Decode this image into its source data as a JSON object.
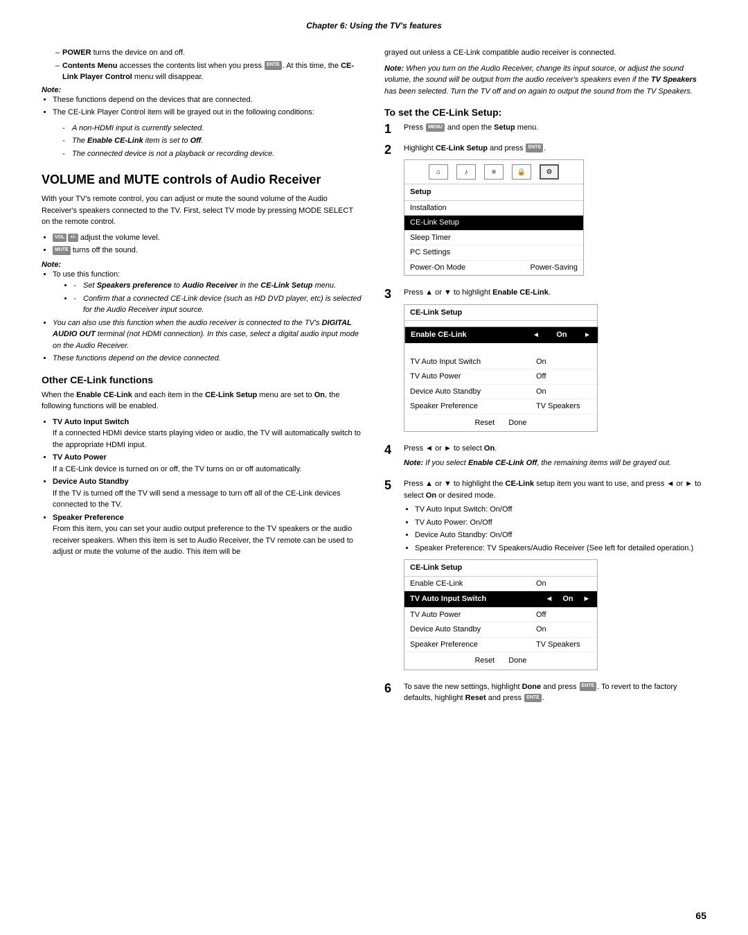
{
  "page": {
    "chapter_header": "Chapter 6: Using the TV's features",
    "page_number": "65",
    "left_col": {
      "bullet_intro": [
        {
          "text": "POWER turns the device on and off.",
          "bold_word": "POWER"
        },
        {
          "text": "Contents Menu accesses the contents list when you press  . At this time, the CE-Link Player Control menu will disappear.",
          "bold_word": "Contents Menu"
        }
      ],
      "note_label": "Note:",
      "note_items": [
        "These functions depend on the devices that are connected.",
        "The CE-Link Player Control item will be grayed out in the following conditions:"
      ],
      "conditions": [
        "A non-HDMI input is currently selected.",
        "The Enable CE-Link item is set to Off.",
        "The connected device is not a playback or recording device."
      ],
      "section1_title": "VOLUME and MUTE controls of Audio Receiver",
      "section1_body": "With your TV's remote control, you can adjust or mute the sound volume of the Audio Receiver's speakers connected to the TV. First, select TV mode by pressing MODE SELECT on the remote control.",
      "section1_bullets": [
        "adjust the volume level.",
        "turns off the sound."
      ],
      "note2_label": "Note:",
      "note2_items": [
        "To use this function:"
      ],
      "note2_sub": [
        "Set Speakers preference to Audio Receiver in the CE-Link Setup menu.",
        "Confirm that a connected CE-Link device (such as HD DVD player, etc) is selected for the Audio Receiver input source."
      ],
      "note2_extra": [
        "You can also use this function when the audio receiver is connected to the TV's DIGITAL AUDIO OUT terminal (not HDMI connection). In this case, select a digital audio input mode on the Audio Receiver.",
        "These functions depend on the device connected."
      ],
      "section2_title": "Other CE-Link functions",
      "section2_body": "When the Enable CE-Link and each item in the CE-Link Setup menu are set to On, the following functions will be enabled.",
      "sub_sections": [
        {
          "title": "TV Auto Input Switch",
          "body": "If a connected HDMI device starts playing video or audio, the TV will automatically switch to the appropriate HDMI input."
        },
        {
          "title": "TV Auto Power",
          "body": "If a CE-Link device is turned on or off, the TV turns on or off automatically."
        },
        {
          "title": "Device Auto Standby",
          "body": "If the TV is turned off the TV will send a message to turn off all of the CE-Link devices connected to the TV."
        },
        {
          "title": "Speaker Preference",
          "body": "From this item, you can set your audio output preference to the TV speakers or the audio receiver speakers. When this item is set to Audio Receiver, the TV remote can be used to adjust or mute the volume of the audio. This item will be"
        }
      ]
    },
    "right_col": {
      "grayed_text": "grayed out unless a CE-Link compatible audio receiver is connected.",
      "note_italic": "Note: When you turn on the Audio Receiver, change its input source, or adjust the sound volume, the sound will be output from the audio receiver's speakers even if the TV Speakers has been selected. Turn the TV off and on again to output the sound from the TV Speakers.",
      "setup_title": "To set the CE-Link Setup:",
      "steps": [
        {
          "num": "1",
          "text": "Press  and open the Setup menu."
        },
        {
          "num": "2",
          "text": "Highlight CE-Link Setup and press  ."
        },
        {
          "num": "3",
          "text": "Press ▲ or ▼ to highlight Enable CE-Link."
        },
        {
          "num": "4",
          "text": "Press ◄ or ► to select On."
        },
        {
          "num": "5",
          "text": "Press ▲ or ▼ to highlight the CE-Link setup item you want to use, and press ◄ or ► to select On or desired mode."
        },
        {
          "num": "6",
          "text": "To save the new settings, highlight Done and press  . To revert to the factory defaults, highlight Reset and press  ."
        }
      ],
      "note_step4": "Note: If you select Enable CE-Link Off, the remaining items will be grayed out.",
      "step5_bullets": [
        "TV Auto Input Switch: On/Off",
        "TV Auto Power: On/Off",
        "Device Auto Standby: On/Off",
        "Speaker Preference: TV Speakers/Audio Receiver (See left for detailed operation.)"
      ],
      "setup_table": {
        "title": "Setup",
        "rows": [
          "Installation",
          "CE-Link Setup",
          "Sleep Timer",
          "PC Settings",
          "Power-On Mode  Power-Saving"
        ],
        "highlighted_row": "CE-Link Setup"
      },
      "ce_link_table1": {
        "title": "CE-Link Setup",
        "enable_row": {
          "label": "Enable CE-Link",
          "value": "On"
        },
        "rows": [
          {
            "label": "TV Auto Input Switch",
            "value": "On"
          },
          {
            "label": "TV Auto Power",
            "value": "Off"
          },
          {
            "label": "Device Auto Standby",
            "value": "On"
          },
          {
            "label": "Speaker Preference",
            "value": "TV Speakers"
          }
        ],
        "footer": [
          "Reset",
          "Done"
        ]
      },
      "ce_link_table2": {
        "title": "CE-Link Setup",
        "rows_plain": [
          {
            "label": "Enable CE-Link",
            "value": "On"
          }
        ],
        "rows_highlight": [
          {
            "label": "TV Auto Input Switch",
            "value": "On"
          }
        ],
        "rows_normal": [
          {
            "label": "TV Auto Power",
            "value": "Off"
          },
          {
            "label": "Device Auto Standby",
            "value": "On"
          },
          {
            "label": "Speaker Preference",
            "value": "TV Speakers"
          }
        ],
        "footer": [
          "Reset",
          "Done"
        ]
      }
    }
  }
}
